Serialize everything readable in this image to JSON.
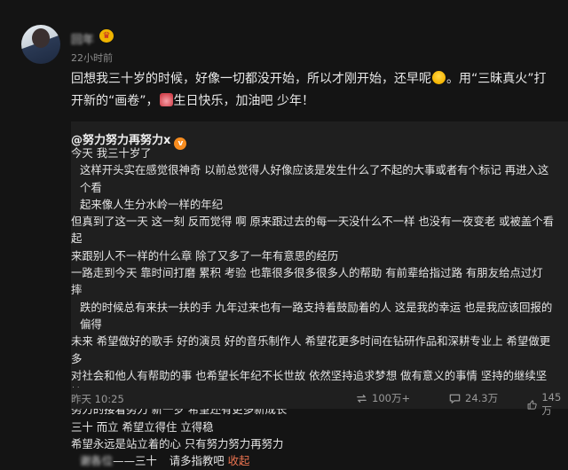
{
  "post": {
    "username": "回年",
    "time": "22小时前",
    "text_1": "回想我三十岁的时候，好像一切都没开始，所以才刚开始，还早呢",
    "text_2": "。用“三昧真火”打开新的“画卷”，",
    "text_3": "生日快乐，加油吧 少年！"
  },
  "repost": {
    "author": "@努力努力再努力x",
    "lines": [
      "今天 我三十岁了",
      "这样开头实在感觉很神奇 以前总觉得人好像应该是发生什么了不起的大事或者有个标记 再进入这个看",
      "起来像人生分水岭一样的年纪",
      "但真到了这一天 这一刻 反而觉得 啊 原来跟过去的每一天没什么不一样 也没有一夜变老 或被盖个看起",
      "来跟别人不一样的什么章 除了又多了一年有意思的经历",
      "一路走到今天 靠时间打磨 累积 考验 也靠很多很多很多人的帮助 有前辈给指过路 有朋友给点过灯 摔",
      "跌的时候总有来扶一扶的手 九年过来也有一路支持着鼓励着的人 这是我的幸运 也是我应该回报的偏得",
      "未来 希望做好的歌手 好的演员 好的音乐制作人 希望花更多时间在钻研作品和深耕专业上 希望做更多",
      "对社会和他人有帮助的事 也希望长年纪不长世故 依然坚持追求梦想 做有意义的事情 坚持的继续坚持",
      "努力的接着努力 新一岁 希望还有更多新成长",
      "三十 而立 希望立得住 立得稳",
      "希望永远是站立着的心 只有努力努力再努力"
    ],
    "last_line_blurred": "谢各位",
    "last_line_mid": "——三十",
    "last_line_end": "请多指教吧",
    "collapse_label": "收起"
  },
  "footer": {
    "date": "昨天 10:25",
    "reposts": "100万+",
    "comments": "24.3万",
    "likes": "145万"
  },
  "colors": {
    "background": "#141414",
    "repost_background": "#1f1f1f",
    "link_orange": "#eb7350"
  },
  "icons": [
    "crown-icon",
    "laugh-emoji-icon",
    "birthday-cake-icon",
    "verified-badge-icon",
    "repost-icon",
    "comment-icon",
    "like-icon"
  ]
}
